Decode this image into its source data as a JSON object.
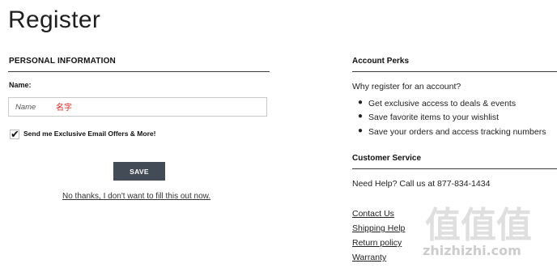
{
  "page": {
    "title": "Register"
  },
  "personal": {
    "heading": "PERSONAL INFORMATION",
    "name_label": "Name:",
    "name_placeholder": "Name",
    "name_annotation": "名字",
    "checkbox_checked": true,
    "checkbox_label": "Send me Exclusive Email Offers & More!",
    "save_label": "SAVE",
    "no_thanks_label": "No thanks, I don't want to fill this out now."
  },
  "perks": {
    "heading": "Account Perks",
    "intro": "Why register for an account?",
    "items": [
      "Get exclusive access to deals & events",
      "Save favorite items to your wishlist",
      "Save your orders and access tracking numbers"
    ]
  },
  "service": {
    "heading": "Customer Service",
    "help_text": "Need Help? Call us at 877-834-1434",
    "links": [
      "Contact Us",
      "Shipping Help",
      "Return policy",
      "Warranty"
    ]
  },
  "watermark": {
    "glyphs": "值值值",
    "text": "zhizhizhi.com"
  }
}
